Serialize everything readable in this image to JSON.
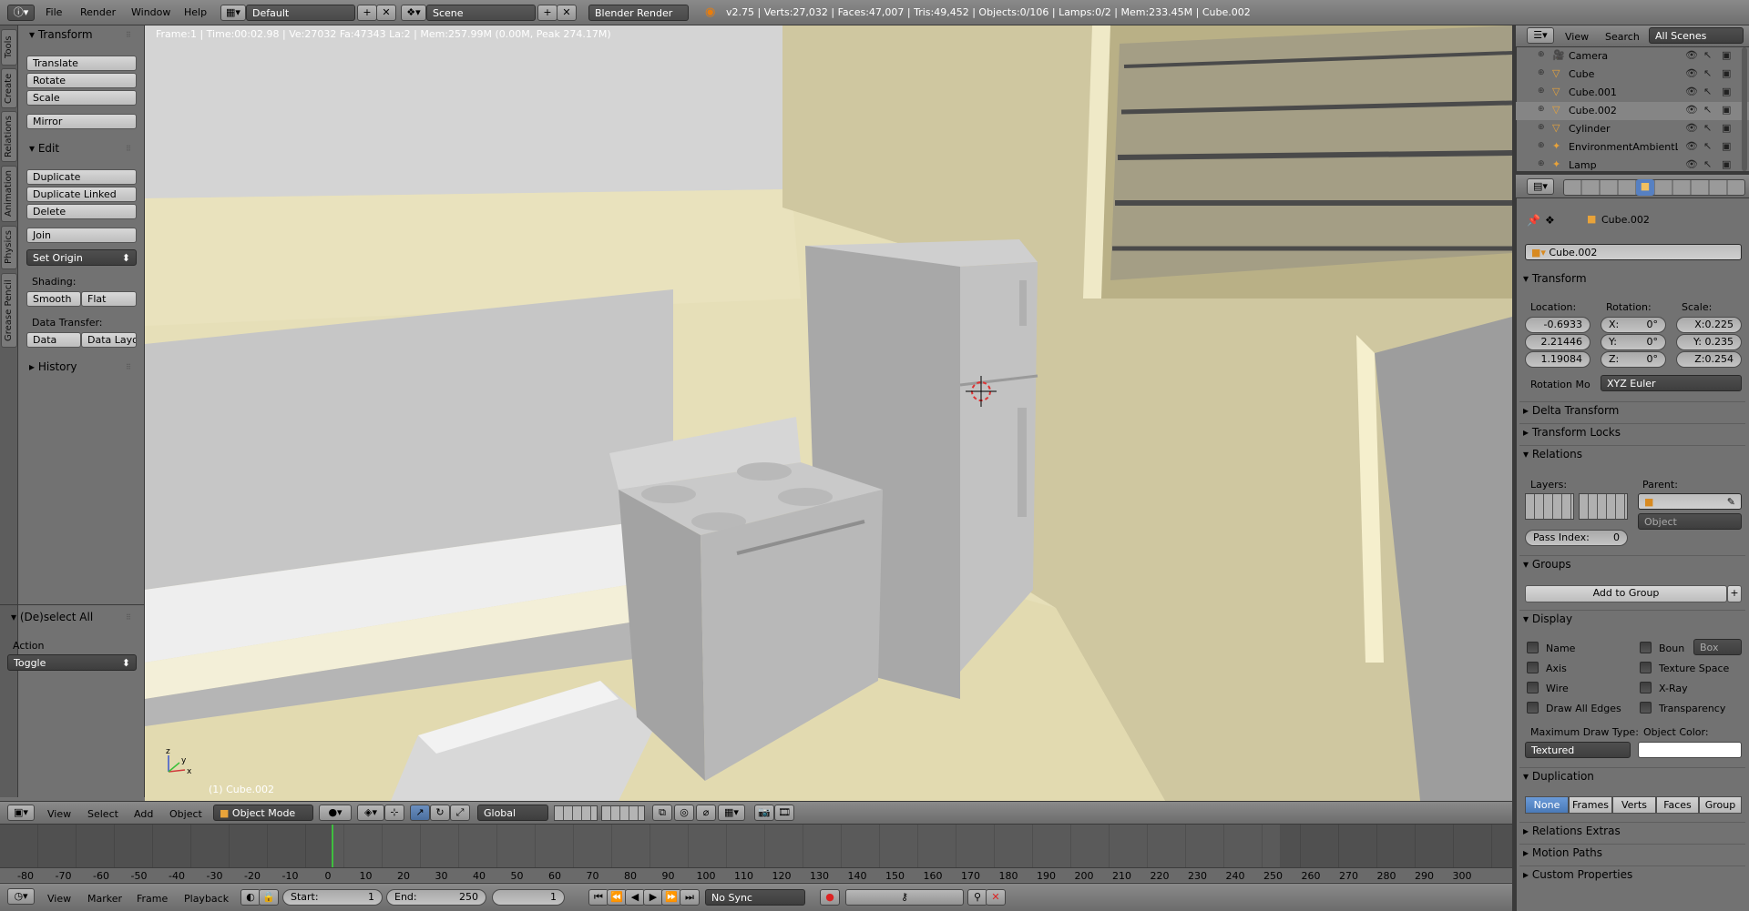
{
  "topbar": {
    "menus": [
      "File",
      "Render",
      "Window",
      "Help"
    ],
    "layout": "Default",
    "scene": "Scene",
    "engine": "Blender Render",
    "stats": "v2.75 | Verts:27,032 | Faces:47,007 | Tris:49,452 | Objects:0/106 | Lamps:0/2 | Mem:233.45M | Cube.002"
  },
  "tabs": [
    "Tools",
    "Create",
    "Relations",
    "Animation",
    "Physics",
    "Grease Pencil"
  ],
  "toolshelf": {
    "transform_title": "Transform",
    "translate": "Translate",
    "rotate": "Rotate",
    "scale": "Scale",
    "mirror": "Mirror",
    "edit_title": "Edit",
    "duplicate": "Duplicate",
    "duplicate_linked": "Duplicate Linked",
    "delete": "Delete",
    "join": "Join",
    "set_origin": "Set Origin",
    "shading_label": "Shading:",
    "smooth": "Smooth",
    "flat": "Flat",
    "data_transfer_label": "Data Transfer:",
    "data": "Data",
    "data_layout": "Data Layo",
    "history_title": "History",
    "operator_title": "(De)select All",
    "action_label": "Action",
    "action_value": "Toggle"
  },
  "viewport": {
    "info": "Frame:1 | Time:00:02.98 | Ve:27032 Fa:47343 La:2 | Mem:257.99M (0.00M, Peak 274.17M)",
    "object_label": "(1) Cube.002",
    "axes": {
      "x": "x",
      "y": "y",
      "z": "z"
    }
  },
  "viewport_header": {
    "menus": [
      "View",
      "Select",
      "Add",
      "Object"
    ],
    "mode": "Object Mode",
    "orientation": "Global"
  },
  "timeline": {
    "ticks": [
      "-80",
      "-70",
      "-60",
      "-50",
      "-40",
      "-30",
      "-20",
      "-10",
      "0",
      "10",
      "20",
      "30",
      "40",
      "50",
      "60",
      "70",
      "80",
      "90",
      "100",
      "110",
      "120",
      "130",
      "140",
      "150",
      "160",
      "170",
      "180",
      "190",
      "200",
      "210",
      "220",
      "230",
      "240",
      "250",
      "260",
      "270",
      "280",
      "290",
      "300"
    ],
    "menus": [
      "View",
      "Marker",
      "Frame",
      "Playback"
    ],
    "start_label": "Start:",
    "start_value": "1",
    "end_label": "End:",
    "end_value": "250",
    "current": "1",
    "sync": "No Sync"
  },
  "outliner": {
    "menus": [
      "View",
      "Search"
    ],
    "scene_filter": "All Scenes",
    "items": [
      "Camera",
      "Cube",
      "Cube.001",
      "Cube.002",
      "Cylinder",
      "EnvironmentAmbientLi",
      "Lamp"
    ]
  },
  "properties": {
    "breadcrumb": "Cube.002",
    "object_name": "Cube.002",
    "transform_title": "Transform",
    "location_label": "Location:",
    "rotation_label": "Rotation:",
    "scale_label": "Scale:",
    "location": [
      "-0.6933",
      "2.21446",
      "1.19084"
    ],
    "rotation": [
      "X:",
      "0°",
      "Y:",
      "0°",
      "Z:",
      "0°"
    ],
    "scale": [
      "X:0.225",
      "Y: 0.235",
      "Z:0.254"
    ],
    "rotation_mode_label": "Rotation Mo",
    "rotation_mode": "XYZ Euler",
    "delta_transform": "Delta Transform",
    "transform_locks": "Transform Locks",
    "relations": "Relations",
    "layers_label": "Layers:",
    "parent_label": "Parent:",
    "parent_type": "Object",
    "pass_index_label": "Pass Index:",
    "pass_index": "0",
    "groups": "Groups",
    "add_to_group": "Add to Group",
    "display": "Display",
    "display_opts": [
      "Name",
      "Axis",
      "Wire",
      "Draw All Edges"
    ],
    "display_opts_right": [
      "Boun",
      "Texture Space",
      "X-Ray",
      "Transparency"
    ],
    "bounds_type": "Box",
    "max_draw_label": "Maximum Draw Type:",
    "max_draw": "Textured",
    "object_color_label": "Object Color:",
    "duplication": "Duplication",
    "dup_opts": [
      "None",
      "Frames",
      "Verts",
      "Faces",
      "Group"
    ],
    "relations_extras": "Relations Extras",
    "motion_paths": "Motion Paths",
    "custom_properties": "Custom Properties"
  }
}
